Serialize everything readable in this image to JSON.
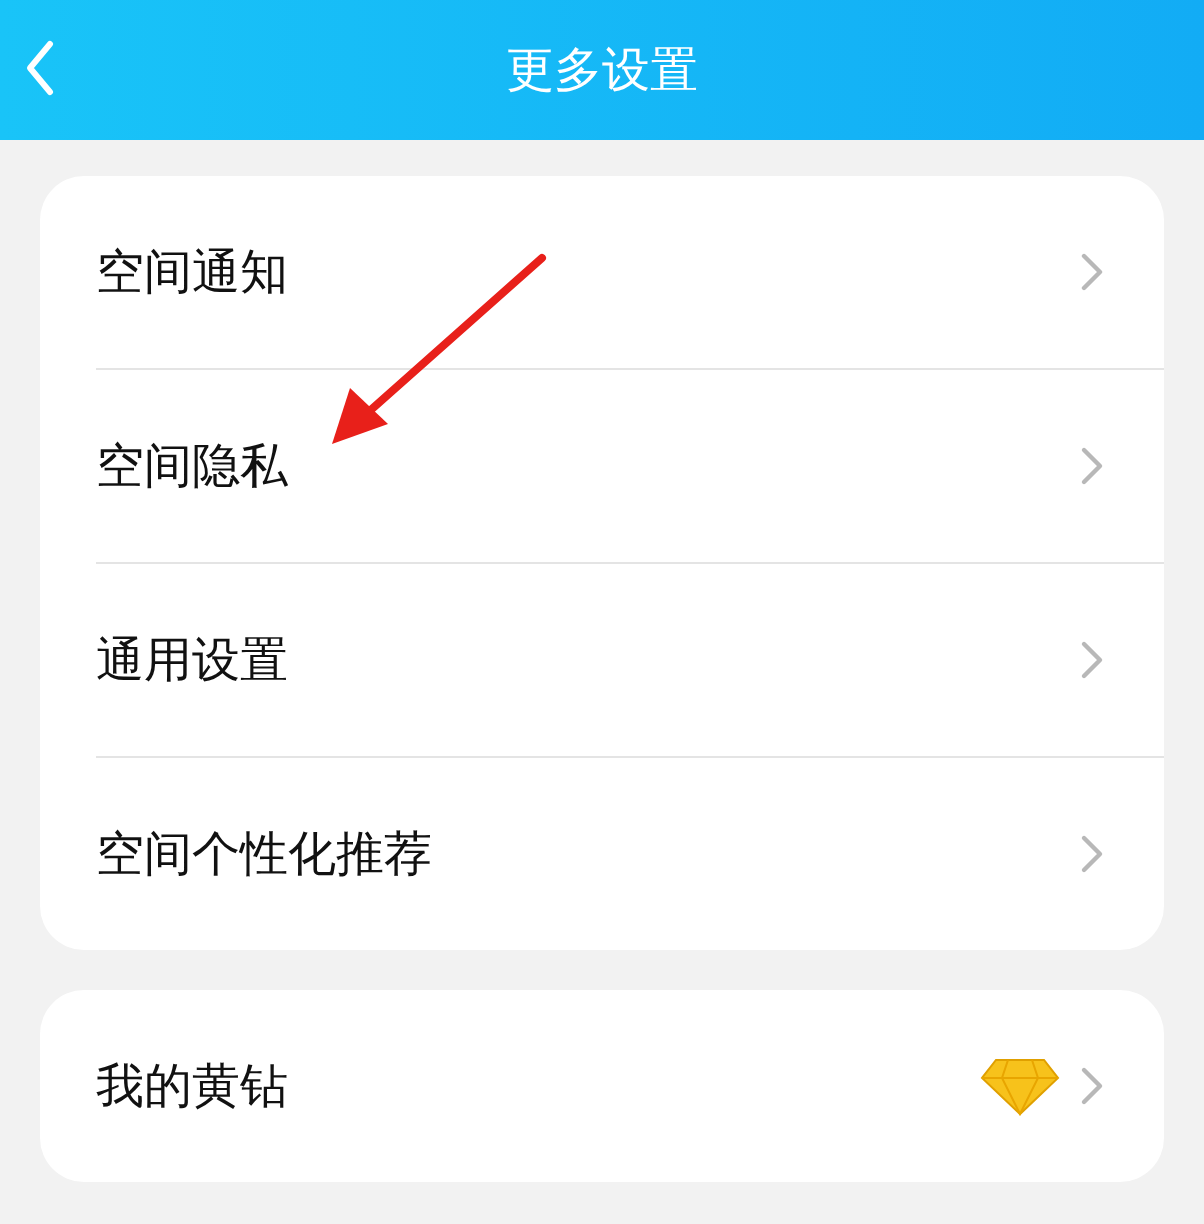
{
  "header": {
    "title": "更多设置"
  },
  "groups": [
    {
      "items": [
        {
          "label": "空间通知",
          "kind": "link"
        },
        {
          "label": "空间隐私",
          "kind": "link"
        },
        {
          "label": "通用设置",
          "kind": "link"
        },
        {
          "label": "空间个性化推荐",
          "kind": "link"
        }
      ]
    },
    {
      "items": [
        {
          "label": "我的黄钻",
          "kind": "diamond"
        }
      ]
    }
  ]
}
